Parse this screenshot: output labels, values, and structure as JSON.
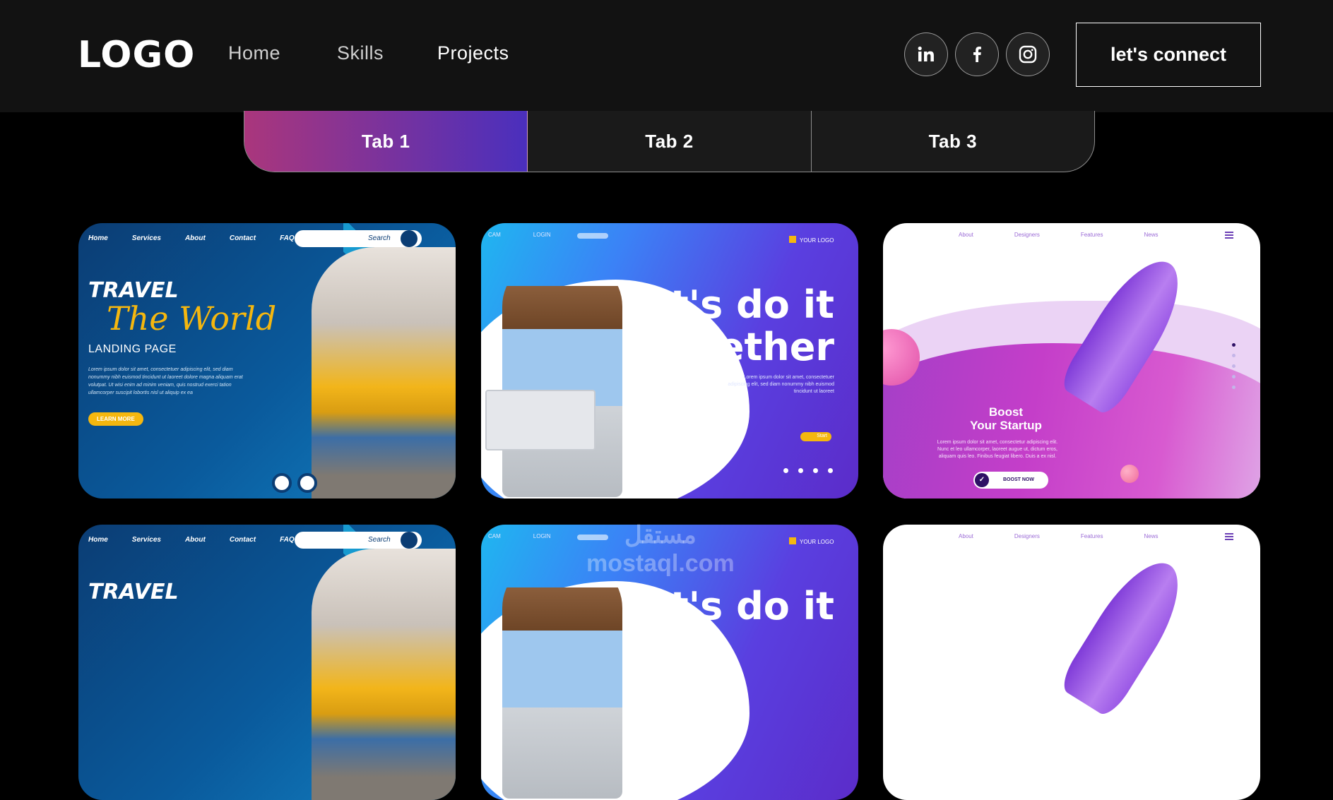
{
  "navbar": {
    "logo": "LOGO",
    "links": [
      "Home",
      "Skills",
      "Projects"
    ],
    "social": [
      {
        "icon": "linkedin-icon",
        "label": "in"
      },
      {
        "icon": "facebook-icon",
        "label": "f"
      },
      {
        "icon": "instagram-icon",
        "label": ""
      }
    ],
    "connect_label": "let's connect"
  },
  "tabs": [
    {
      "label": "Tab 1",
      "active": true
    },
    {
      "label": "Tab 2",
      "active": false
    },
    {
      "label": "Tab 3",
      "active": false
    }
  ],
  "colors": {
    "background": "#000000",
    "navbar": "#121212",
    "tab_gradient_start": "#aa367c",
    "tab_gradient_end": "#4a2fbd"
  },
  "projects": {
    "travel": {
      "nav": [
        "Home",
        "Services",
        "About",
        "Contact",
        "FAQ"
      ],
      "search_placeholder": "Search",
      "title_line1": "TRAVEL",
      "title_line2": "The World",
      "subtitle": "LANDING PAGE",
      "body": "Lorem ipsum dolor sit amet, consectetuer adipiscing elit, sed diam nonummy nibh euismod tincidunt ut laoreet dolore magna aliquam erat volutpat. Ut wisi enim ad minim veniam, quis nostrud exerci tation ullamcorper suscipit lobortis nisl ut aliquip ex ea",
      "button": "LEARN MORE"
    },
    "together": {
      "nav": [
        "CAM",
        "LOGIN"
      ],
      "brand": "YOUR LOGO",
      "headline_line1": "let's do it",
      "headline_line2": "together",
      "body": "Lorem ipsum dolor sit amet, consectetuer adipiscing elit, sed diam nonummy nibh euismod tincidunt ut laoreet",
      "button": "Start"
    },
    "startup": {
      "nav": [
        "About",
        "Designers",
        "Features",
        "News"
      ],
      "title_line1": "Boost",
      "title_line2": "Your Startup",
      "body": "Lorem ipsum dolor sit amet, consectetur adipiscing elit. Nunc et leo ullamcorper, laoreet augue ut, dictum eros, aliquam quis leo. Finibus feugiat libero. Duis a ex nisl.",
      "button": "BOOST NOW"
    }
  },
  "watermark": {
    "arabic": "مستقل",
    "latin": "mostaql.com"
  }
}
